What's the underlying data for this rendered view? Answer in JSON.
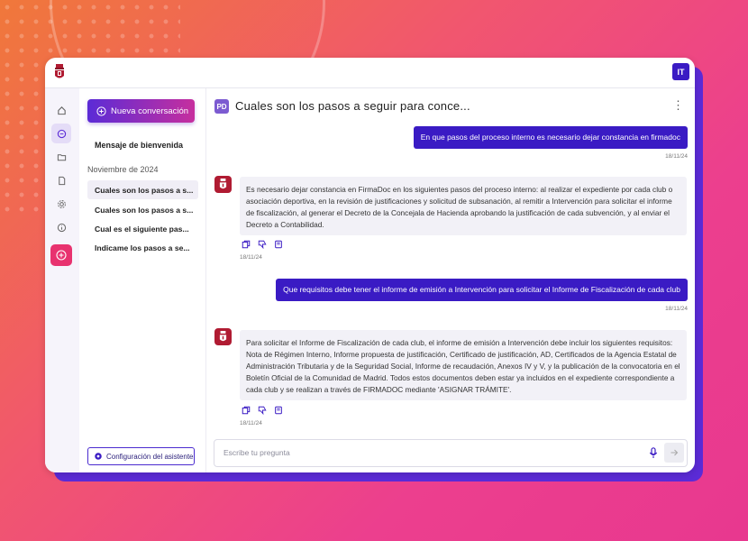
{
  "header": {
    "user_initials": "IT"
  },
  "sidebar": {
    "new_conversation_label": "Nueva conversación",
    "welcome_label": "Mensaje de bienvenida",
    "date_group": "Noviembre de 2024",
    "conversations": [
      "Cuales son los pasos a s...",
      "Cuales son los pasos a s...",
      "Cual es el siguiente pas...",
      "Indicame los pasos a se..."
    ],
    "config_label": "Configuración del asistente"
  },
  "chat": {
    "badge": "PD",
    "title": "Cuales son los pasos a seguir para conce...",
    "messages": [
      {
        "role": "user",
        "text": "En que pasos del proceso interno es necesario dejar constancia en firmadoc",
        "date": "18/11/24"
      },
      {
        "role": "assistant",
        "text": "Es necesario dejar constancia en FirmaDoc en los siguientes pasos del proceso interno: al realizar el expediente por cada club o asociación deportiva, en la revisión de justificaciones y solicitud de subsanación, al remitir a Intervención para solicitar el informe de fiscalización, al generar el Decreto de la Concejala de Hacienda aprobando la justificación de cada subvención, y al enviar el Decreto a Contabilidad.",
        "date": "18/11/24"
      },
      {
        "role": "user",
        "text": "Que requisitos debe tener el informe de emisión a Intervención para solicitar el Informe de Fiscalización de cada club",
        "date": "18/11/24"
      },
      {
        "role": "assistant",
        "text": "Para solicitar el Informe de Fiscalización de cada club, el informe de emisión a Intervención debe incluir los siguientes requisitos: Nota de Régimen Interno, Informe propuesta de justificación, Certificado de justificación, AD, Certificados de la Agencia Estatal de Administración Tributaria y de la Seguridad Social, Informe de recaudación, Anexos IV y V, y la publicación de la convocatoria en el Boletín Oficial de la Comunidad de Madrid. Todos estos documentos deben estar ya incluidos en el expediente correspondiente a cada club y se realizan a través de FIRMADOC mediante 'ASIGNAR TRÁMITE'.",
        "date": "18/11/24"
      }
    ]
  },
  "input": {
    "placeholder": "Escribe tu pregunta"
  },
  "colors": {
    "accent": "#3a1bc4",
    "brand_red": "#b01b32",
    "new_button": "#e8326f"
  }
}
